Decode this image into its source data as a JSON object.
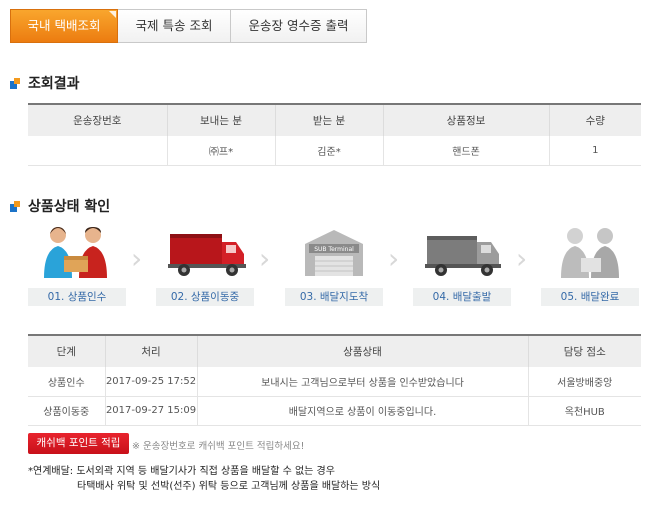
{
  "tabs": [
    {
      "label": "국내 택배조회",
      "active": true
    },
    {
      "label": "국제 특송 조회",
      "active": false
    },
    {
      "label": "운송장 영수증 출력",
      "active": false
    }
  ],
  "result": {
    "title": "조회결과",
    "headers": [
      "운송장번호",
      "보내는 분",
      "받는 분",
      "상품정보",
      "수량"
    ],
    "row": [
      "",
      "㈜프*",
      "김준*",
      "핸드폰",
      "1"
    ]
  },
  "status": {
    "title": "상품상태 확인",
    "steps": [
      {
        "label": "01. 상품인수",
        "icon": "handover-people-icon"
      },
      {
        "label": "02. 상품이동중",
        "icon": "red-truck-icon"
      },
      {
        "label": "03. 배달지도착",
        "icon": "sub-terminal-icon",
        "sign": "SUB Terminal"
      },
      {
        "label": "04. 배달출발",
        "icon": "gray-truck-icon"
      },
      {
        "label": "05. 배달완료",
        "icon": "delivered-people-icon"
      }
    ],
    "headers": [
      "단계",
      "처리",
      "상품상태",
      "담당 점소"
    ],
    "rows": [
      [
        "상품인수",
        "2017-09-25 17:52",
        "보내시는 고객님으로부터 상품을 인수받았습니다",
        "서울방배중앙"
      ],
      [
        "상품이동중",
        "2017-09-27 15:09",
        "배달지역으로 상품이 이동중입니다.",
        "옥천HUB"
      ]
    ]
  },
  "cashback": {
    "button": "캐쉬백 포인트 적립",
    "hint": "※ 운송장번호로 캐쉬백 포인트 적립하세요!"
  },
  "note": {
    "line1": "*연계배달: 도서외곽 지역 등 배달기사가 직접 상품을 배달할 수 없는 경우",
    "line2": "타택배사 위탁 및 선박(선주) 위탁 등으로 고객님께 상품을 배달하는 방식"
  },
  "colors": {
    "accent": "#f39a1e",
    "blue": "#1c73c8",
    "red": "#c8101a"
  }
}
